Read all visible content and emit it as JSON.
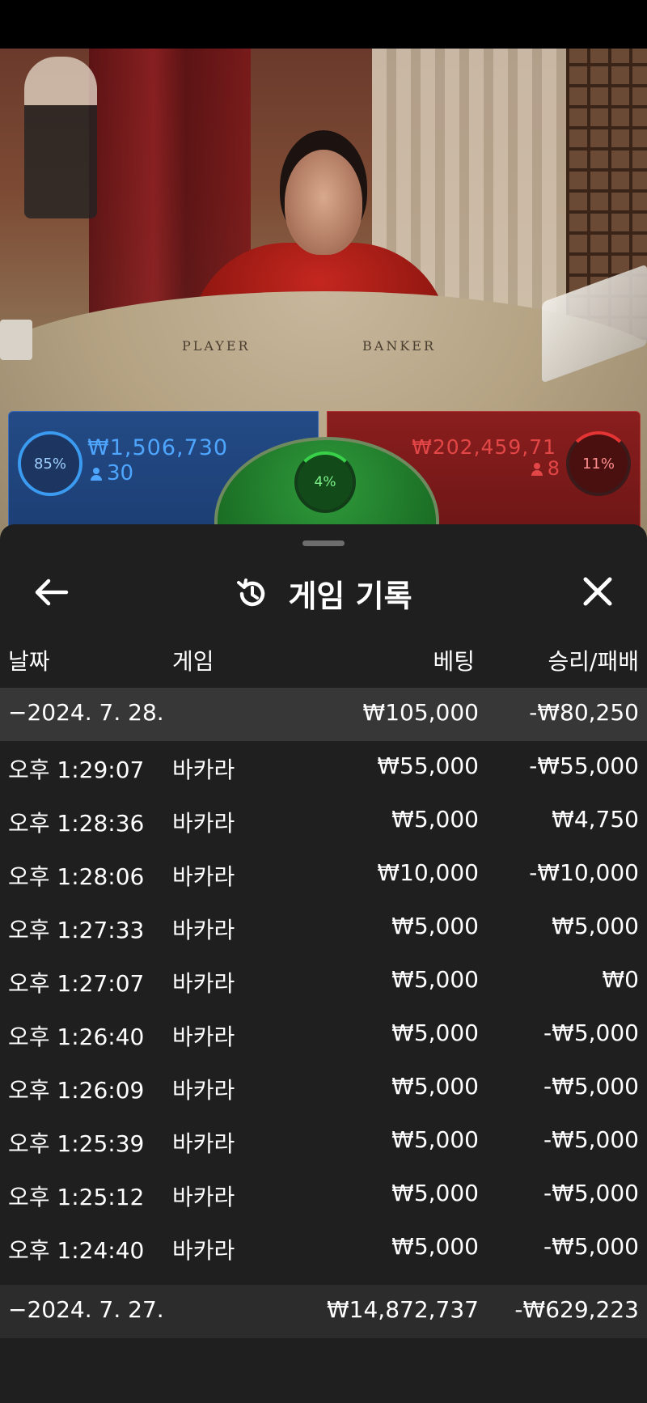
{
  "stream": {
    "table_labels": {
      "player": "PLAYER",
      "banker": "BANKER"
    }
  },
  "bets": {
    "player": {
      "percent": "85%",
      "amount": "₩1,506,730",
      "count": "30",
      "color": "#3a9bf0"
    },
    "tie": {
      "percent": "4%",
      "color": "#3ad14a"
    },
    "banker": {
      "percent": "11%",
      "amount": "₩202,459,71",
      "count": "8",
      "color": "#e43434"
    }
  },
  "history": {
    "title": "게임 기록",
    "icons": {
      "back": "arrow-left-icon",
      "title": "history-icon",
      "close": "close-icon"
    },
    "columns": {
      "date": "날짜",
      "game": "게임",
      "bet": "베팅",
      "result": "승리/패배"
    },
    "groups": [
      {
        "date": "−2024. 7. 28.",
        "bet_total": "₩105,000",
        "result_total": "-₩80,250",
        "rows": [
          {
            "time": "오후 1:29:07",
            "game": "바카라",
            "bet": "₩55,000",
            "result": "-₩55,000"
          },
          {
            "time": "오후 1:28:36",
            "game": "바카라",
            "bet": "₩5,000",
            "result": "₩4,750"
          },
          {
            "time": "오후 1:28:06",
            "game": "바카라",
            "bet": "₩10,000",
            "result": "-₩10,000"
          },
          {
            "time": "오후 1:27:33",
            "game": "바카라",
            "bet": "₩5,000",
            "result": "₩5,000"
          },
          {
            "time": "오후 1:27:07",
            "game": "바카라",
            "bet": "₩5,000",
            "result": "₩0"
          },
          {
            "time": "오후 1:26:40",
            "game": "바카라",
            "bet": "₩5,000",
            "result": "-₩5,000"
          },
          {
            "time": "오후 1:26:09",
            "game": "바카라",
            "bet": "₩5,000",
            "result": "-₩5,000"
          },
          {
            "time": "오후 1:25:39",
            "game": "바카라",
            "bet": "₩5,000",
            "result": "-₩5,000"
          },
          {
            "time": "오후 1:25:12",
            "game": "바카라",
            "bet": "₩5,000",
            "result": "-₩5,000"
          },
          {
            "time": "오후 1:24:40",
            "game": "바카라",
            "bet": "₩5,000",
            "result": "-₩5,000"
          }
        ]
      },
      {
        "date": "−2024. 7. 27.",
        "bet_total": "₩14,872,737",
        "result_total": "-₩629,223",
        "rows": []
      }
    ]
  }
}
